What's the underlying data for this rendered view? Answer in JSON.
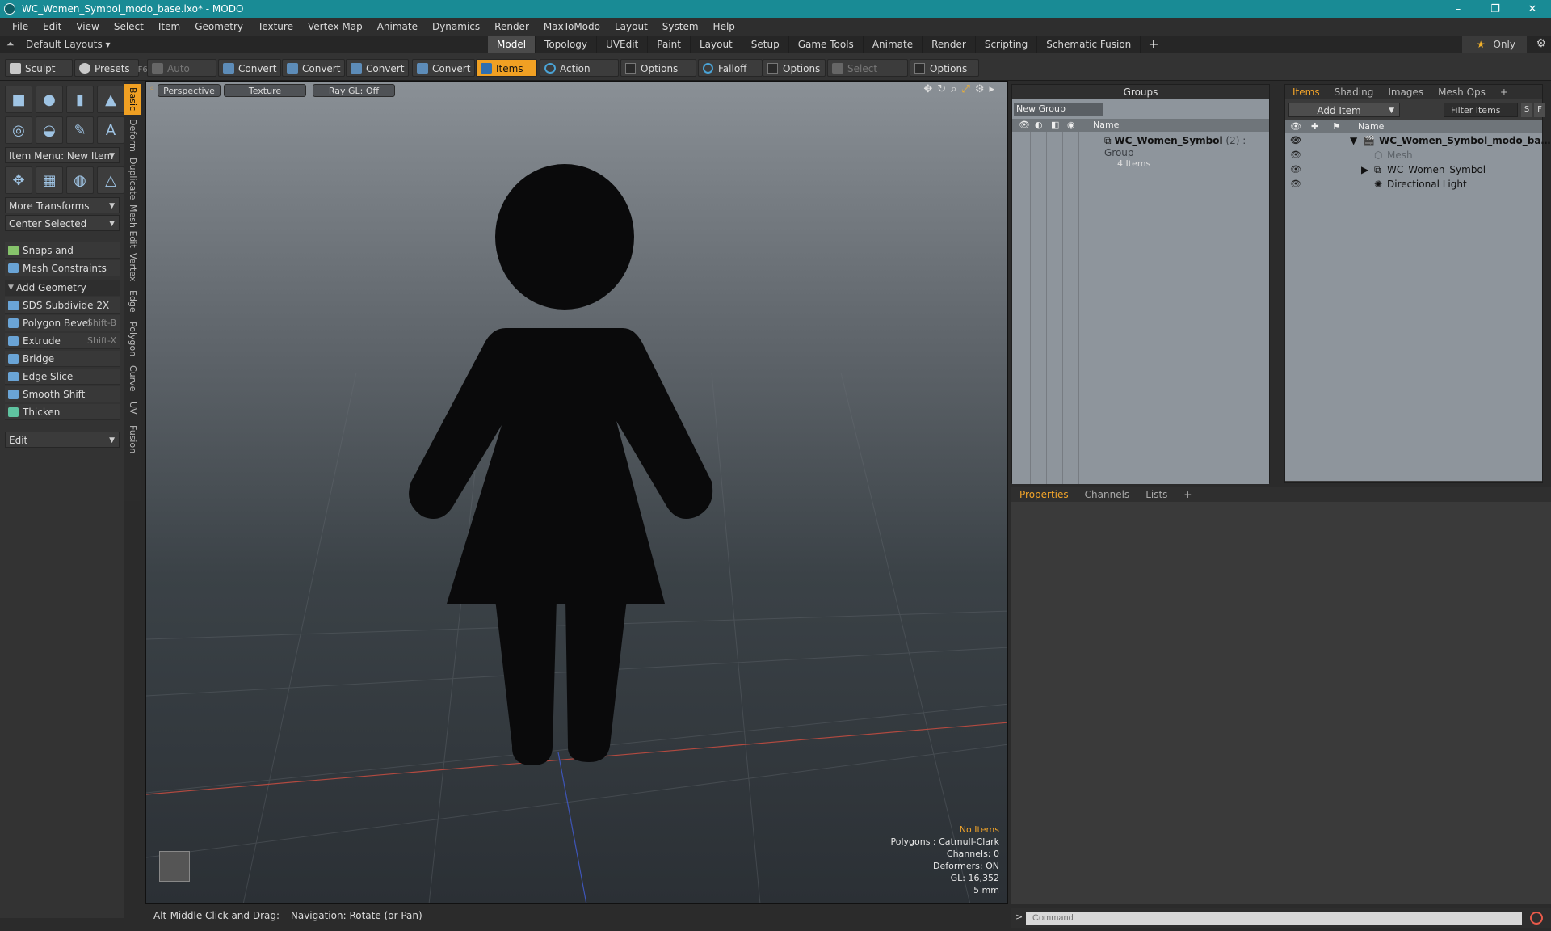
{
  "window": {
    "title": "WC_Women_Symbol_modo_base.lxo* - MODO",
    "minimize": "–",
    "maximize": "❐",
    "close": "✕"
  },
  "menu": [
    "File",
    "Edit",
    "View",
    "Select",
    "Item",
    "Geometry",
    "Texture",
    "Vertex Map",
    "Animate",
    "Dynamics",
    "Render",
    "MaxToModo",
    "Layout",
    "System",
    "Help"
  ],
  "layout": {
    "default": "Default Layouts ▾",
    "tabs": [
      "Model",
      "Topology",
      "UVEdit",
      "Paint",
      "Layout",
      "Setup",
      "Game Tools",
      "Animate",
      "Render",
      "Scripting",
      "Schematic Fusion"
    ],
    "active_tab": "Model",
    "plus": "+",
    "only": "Only"
  },
  "toolbar": {
    "sculpt": "Sculpt",
    "presets": "Presets",
    "presets_key": "F6",
    "auto_select": "Auto Select",
    "convert": "Convert",
    "items": "Items",
    "action_center": "Action Center",
    "options": "Options",
    "falloff": "Falloff",
    "select_through": "Select Through"
  },
  "left": {
    "item_menu": "Item Menu: New Item",
    "more_transforms": "More Transforms",
    "center_selected": "Center Selected",
    "snaps": "Snaps and Precision",
    "mesh_constraints": "Mesh Constraints",
    "add_geometry": "Add Geometry",
    "tools": [
      {
        "label": "SDS Subdivide 2X",
        "key": ""
      },
      {
        "label": "Polygon Bevel",
        "key": "Shift-B"
      },
      {
        "label": "Extrude",
        "key": "Shift-X"
      },
      {
        "label": "Bridge",
        "key": ""
      },
      {
        "label": "Edge Slice",
        "key": ""
      },
      {
        "label": "Smooth Shift",
        "key": ""
      },
      {
        "label": "Thicken",
        "key": ""
      }
    ],
    "edit": "Edit",
    "vtabs": [
      "Basic",
      "Deform",
      "Duplicate",
      "Mesh Edit",
      "Vertex",
      "Edge",
      "Polygon",
      "Curve",
      "UV",
      "Fusion"
    ]
  },
  "viewport": {
    "perspective": "Perspective",
    "texture": "Texture",
    "raygl": "Ray GL: Off",
    "info": {
      "no_items": "No Items",
      "polygons": "Polygons : Catmull-Clark",
      "channels": "Channels: 0",
      "deformers": "Deformers: ON",
      "gl": "GL: 16,352",
      "scale": "5 mm"
    }
  },
  "status": {
    "action": "Alt-Middle Click and Drag:",
    "nav": "Navigation: Rotate (or Pan)"
  },
  "groups": {
    "title": "Groups",
    "new_group": "New Group",
    "col_name": "Name",
    "row_name": "WC_Women_Symbol",
    "row_count": "(2)",
    "row_type": ": Group",
    "row_items": "4 Items"
  },
  "items": {
    "tabs": [
      "Items",
      "Shading",
      "Images",
      "Mesh Ops"
    ],
    "plus": "+",
    "add_item": "Add Item",
    "filter": "Filter Items",
    "s": "S",
    "f": "F",
    "col_name": "Name",
    "rows": [
      "WC_Women_Symbol_modo_ba…",
      "Mesh",
      "WC_Women_Symbol",
      "Directional Light"
    ]
  },
  "props": {
    "tabs": [
      "Properties",
      "Channels",
      "Lists"
    ],
    "plus": "+"
  },
  "command": {
    "placeholder": "Command"
  },
  "colors": {
    "title": "#198b95",
    "accent": "#f0a023",
    "figure": "#0a0a0b"
  }
}
